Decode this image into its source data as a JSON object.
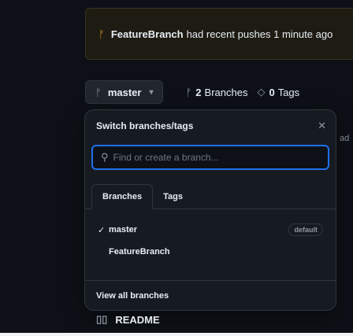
{
  "banner": {
    "icon": "git-branch-icon",
    "branch": "FeatureBranch",
    "text": "had recent pushes 1 minute ago"
  },
  "toolbar": {
    "branch_icon": "git-branch-icon",
    "branch_label": "master",
    "caret": "▾",
    "branches_count": "2",
    "branches_label": "Branches",
    "tags_count": "0",
    "tags_label": "Tags"
  },
  "panel": {
    "title": "Switch branches/tags",
    "close": "✕",
    "search_placeholder": "Find or create a branch...",
    "tabs": [
      {
        "label": "Branches"
      },
      {
        "label": "Tags"
      }
    ],
    "items": [
      {
        "check": "✓",
        "name": "master",
        "badge": "default"
      },
      {
        "check": "",
        "name": "FeatureBranch"
      }
    ],
    "footer": "View all branches"
  },
  "peek_text": "ad",
  "readme": {
    "icon": "book-icon",
    "label": "README"
  },
  "colors": {
    "accent": "#1f6feb",
    "banner_icon": "#d29922",
    "bg": "#0d1117"
  }
}
